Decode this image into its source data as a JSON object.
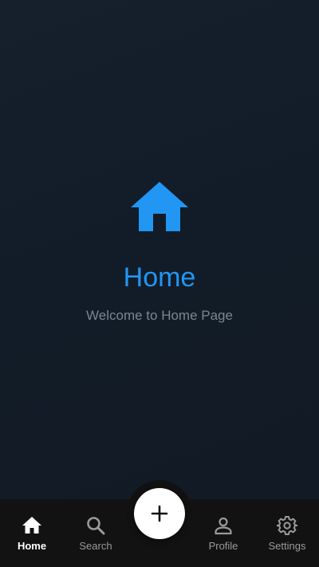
{
  "main": {
    "title": "Home",
    "subtitle": "Welcome to Home Page",
    "icon": "home-icon"
  },
  "bottom_nav": {
    "items": [
      {
        "label": "Home",
        "icon": "home-icon",
        "active": true
      },
      {
        "label": "Search",
        "icon": "search-icon",
        "active": false
      },
      {
        "label": "Profile",
        "icon": "person-icon",
        "active": false
      },
      {
        "label": "Settings",
        "icon": "gear-icon",
        "active": false
      }
    ],
    "fab_icon": "plus-icon"
  },
  "colors": {
    "accent": "#2196f3",
    "background": "#131d28",
    "nav_background": "#121212",
    "nav_active": "#ffffff",
    "nav_inactive": "#9a9a9a",
    "subtitle": "#7c8591"
  }
}
